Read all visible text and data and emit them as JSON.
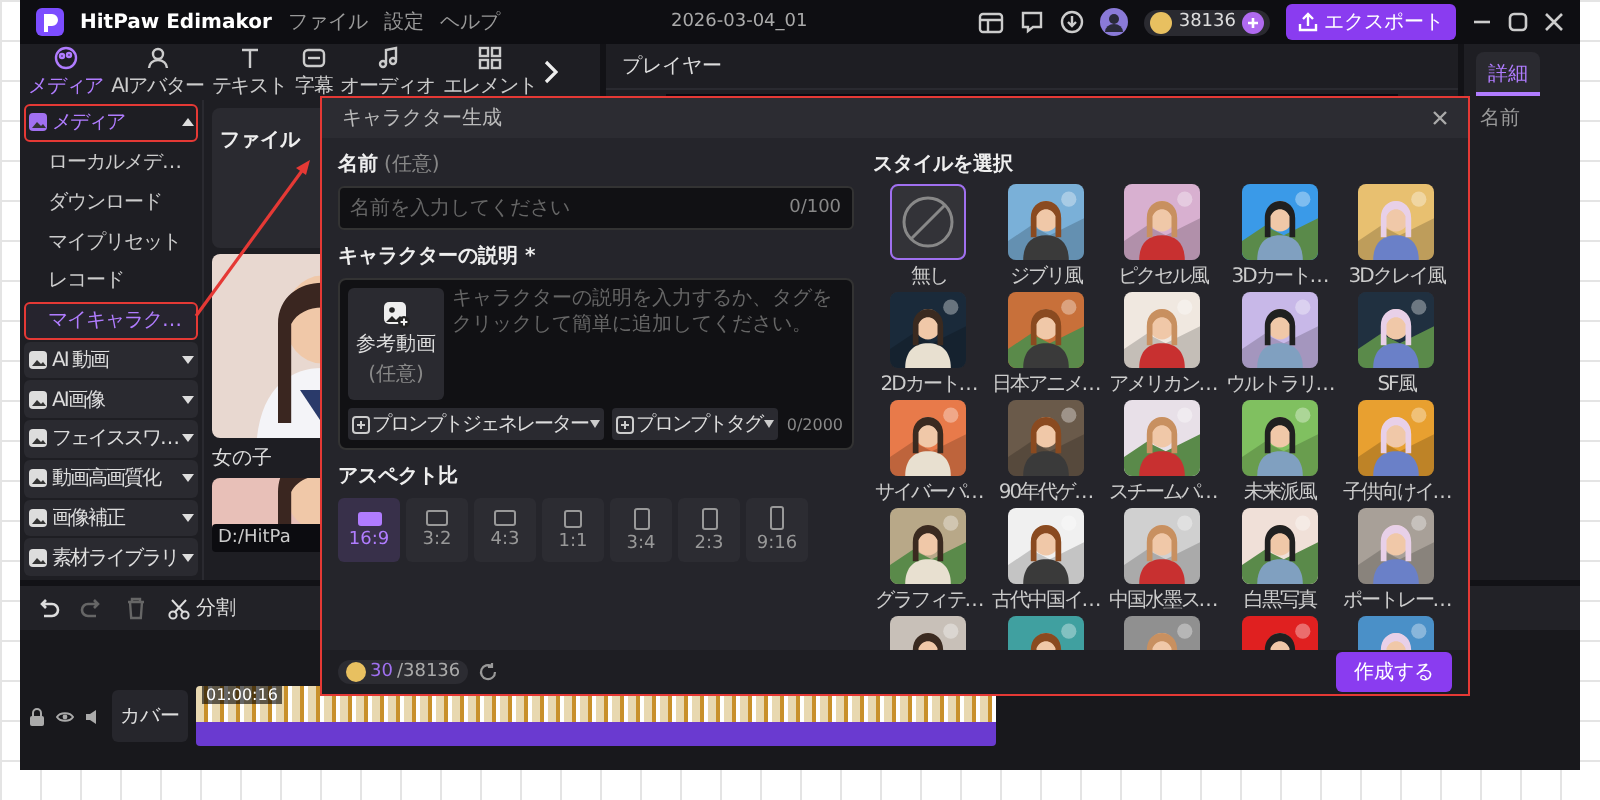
{
  "window": {
    "app_name": "HitPaw Edimakor",
    "menu": [
      "ファイル",
      "設定",
      "ヘルプ"
    ],
    "project": "2026-03-04_01",
    "coins": "38136",
    "export": "エクスポート"
  },
  "toolbar_tabs": [
    {
      "label": "メディア",
      "selected": true
    },
    {
      "label": "AIアバター",
      "selected": false
    },
    {
      "label": "テキスト",
      "selected": false
    },
    {
      "label": "字幕",
      "selected": false
    },
    {
      "label": "オーディオ",
      "selected": false
    },
    {
      "label": "エレメント",
      "selected": false
    }
  ],
  "sidebar": {
    "items": [
      {
        "label": "メディア",
        "expanded": true,
        "annotated": true,
        "children": [
          {
            "label": "ローカルメデ…",
            "selected": false,
            "annotated": false
          },
          {
            "label": "ダウンロード",
            "selected": false,
            "annotated": false
          },
          {
            "label": "マイプリセット",
            "selected": false,
            "annotated": false
          },
          {
            "label": "レコード",
            "selected": false,
            "annotated": false
          },
          {
            "label": "マイキャラク…",
            "selected": true,
            "annotated": true
          }
        ]
      },
      {
        "label": "AI 動画",
        "expanded": false,
        "annotated": false
      },
      {
        "label": "AI画像",
        "expanded": false,
        "annotated": false
      },
      {
        "label": "フェイススワ…",
        "expanded": false,
        "annotated": false
      },
      {
        "label": "動画高画質化",
        "expanded": false,
        "annotated": false
      },
      {
        "label": "画像補正",
        "expanded": false,
        "annotated": false
      },
      {
        "label": "素材ライブラリ",
        "expanded": false,
        "annotated": false
      }
    ]
  },
  "media": {
    "card": "ファイル",
    "clips": [
      {
        "kind": "picture",
        "label": "女の子"
      },
      {
        "kind": "picture"
      }
    ],
    "path": "D:/HitPa"
  },
  "player": {
    "title": "プレイヤー"
  },
  "details": {
    "tabs": [
      {
        "label": "詳細",
        "selected": true
      }
    ],
    "field": "名前"
  },
  "timeline": {
    "split": "分割",
    "track_label": "カバー",
    "clip_time": "01:00:16"
  },
  "dialog": {
    "title": "キャラクター生成",
    "name_label": "名前",
    "name_hint": "(任意)",
    "name_placeholder": "名前を入力してください",
    "name_count": "0/100",
    "desc_label": "キャラクターの説明 *",
    "reference": {
      "label": "参考動画",
      "hint": "(任意)"
    },
    "desc_placeholder": "キャラクターの説明を入力するか、タグをクリックして簡単に追加してください。",
    "prompt_buttons": [
      "プロンプトジェネレーター",
      "プロンプトタグ"
    ],
    "desc_count": "0/2000",
    "aspect_label": "アスペクト比",
    "aspects": [
      {
        "label": "16:9",
        "kind": "wide",
        "selected": true
      },
      {
        "label": "3:2",
        "kind": "landscape",
        "selected": false
      },
      {
        "label": "4:3",
        "kind": "landscape",
        "selected": false
      },
      {
        "label": "1:1",
        "kind": "square",
        "selected": false
      },
      {
        "label": "3:4",
        "kind": "portrait",
        "selected": false
      },
      {
        "label": "2:3",
        "kind": "portrait",
        "selected": false
      },
      {
        "label": "9:16",
        "kind": "tall",
        "selected": false
      }
    ],
    "style_label": "スタイルを選択",
    "styles": [
      {
        "kind": "none",
        "label": "無し",
        "selected": true
      },
      {
        "kind": "picture",
        "label": "ジブリ風",
        "selected": false
      },
      {
        "kind": "picture",
        "label": "ピクセル風",
        "selected": false
      },
      {
        "kind": "picture",
        "label": "3Dカート…",
        "selected": false
      },
      {
        "kind": "picture",
        "label": "3Dクレイ風",
        "selected": false
      },
      {
        "kind": "picture",
        "label": "2Dカート…",
        "selected": false
      },
      {
        "kind": "picture",
        "label": "日本アニメ…",
        "selected": false
      },
      {
        "kind": "picture",
        "label": "アメリカン…",
        "selected": false
      },
      {
        "kind": "picture",
        "label": "ウルトラリ…",
        "selected": false
      },
      {
        "kind": "picture",
        "label": "SF風",
        "selected": false
      },
      {
        "kind": "picture",
        "label": "サイバーパ…",
        "selected": false
      },
      {
        "kind": "picture",
        "label": "90年代ゲ…",
        "selected": false
      },
      {
        "kind": "picture",
        "label": "スチームパ…",
        "selected": false
      },
      {
        "kind": "picture",
        "label": "未来派風",
        "selected": false
      },
      {
        "kind": "picture",
        "label": "子供向けイ…",
        "selected": false
      },
      {
        "kind": "picture",
        "label": "グラフィテ…",
        "selected": false
      },
      {
        "kind": "picture",
        "label": "古代中国イ…",
        "selected": false
      },
      {
        "kind": "picture",
        "label": "中国水墨ス…",
        "selected": false
      },
      {
        "kind": "picture",
        "label": "白黒写真",
        "selected": false
      },
      {
        "kind": "picture",
        "label": "ポートレー…",
        "selected": false
      },
      {
        "kind": "picture",
        "selected": false
      },
      {
        "kind": "picture",
        "selected": false
      },
      {
        "kind": "picture",
        "selected": false
      },
      {
        "kind": "picture",
        "selected": false
      },
      {
        "kind": "picture",
        "selected": false
      }
    ],
    "cost": "30",
    "balance": "/38136",
    "create": "作成する"
  }
}
